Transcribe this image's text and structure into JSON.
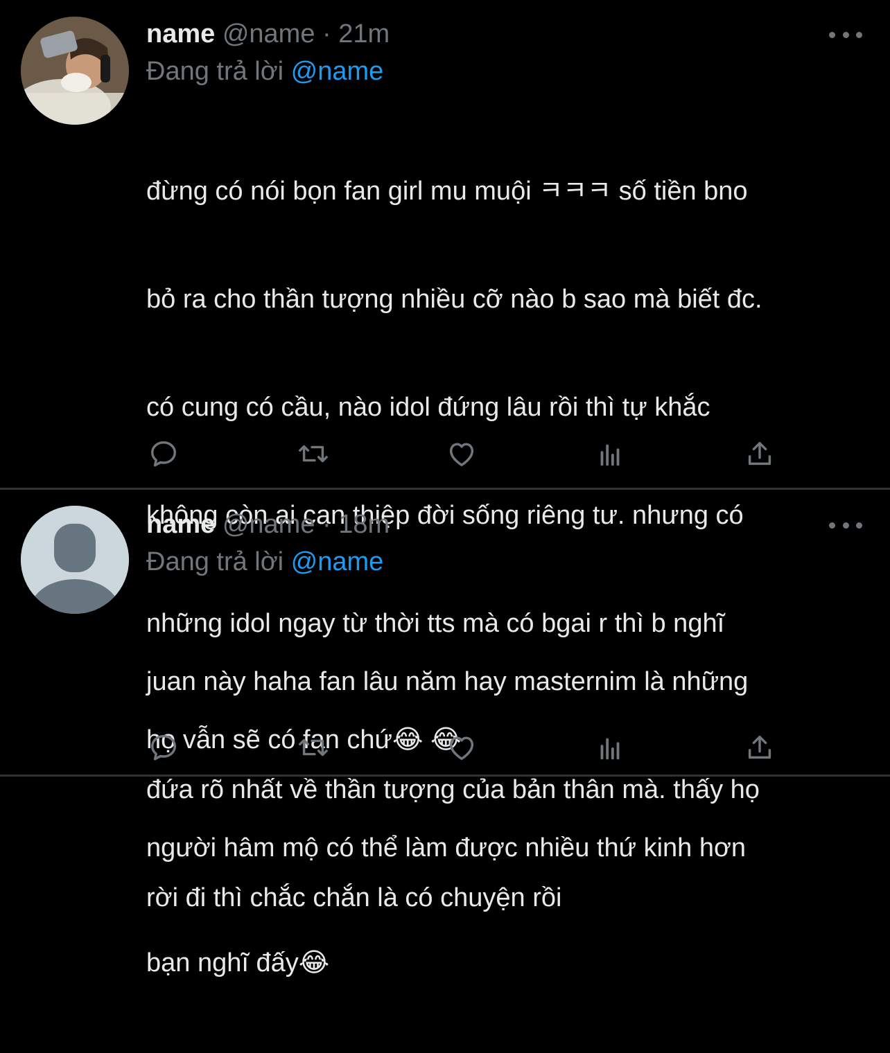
{
  "tweets": [
    {
      "name": "name",
      "handle": "@name",
      "separator": "·",
      "time": "21m",
      "reply_prefix": "Đang trả lời",
      "reply_to": "@name",
      "text_lines": [
        "đừng có nói bọn fan girl mu muội ㅋㅋㅋ số tiền bno",
        "bỏ ra cho thần tượng nhiều cỡ nào b sao mà biết đc.",
        "có cung có cầu, nào idol đứng lâu rồi thì tự khắc",
        "không còn ai can thiệp đời sống riêng tư. nhưng có",
        "những idol ngay từ thời tts mà có bgai r thì b nghĩ",
        "họ vẫn sẽ có fan chứ😂 😂",
        "người hâm mộ có thể làm được nhiều thứ kinh hơn",
        "bạn nghĩ đấy😂"
      ],
      "avatar": "user-photo"
    },
    {
      "name": "name",
      "handle": "@name",
      "separator": "·",
      "time": "18m",
      "reply_prefix": "Đang trả lời",
      "reply_to": "@name",
      "text_lines": [
        "juan này haha fan lâu năm hay masternim là những",
        "đứa rõ nhất về thần tượng của bản thân mà. thấy họ",
        "rời đi thì chắc chắn là có chuyện rồi"
      ],
      "avatar": "default-avatar"
    }
  ],
  "actions": [
    "reply-icon",
    "retweet-icon",
    "like-icon",
    "views-icon",
    "share-icon"
  ],
  "colors": {
    "background": "#000000",
    "text": "#e7e9ea",
    "muted": "#71767b",
    "link": "#1d9bf0",
    "divider": "#2f3336"
  }
}
